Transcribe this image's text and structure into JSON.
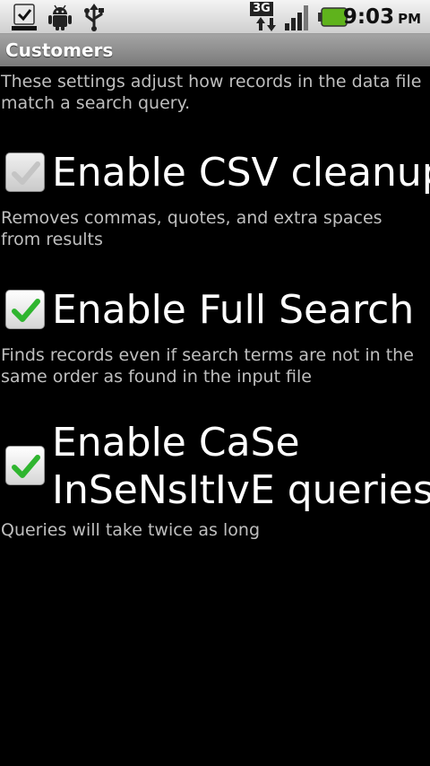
{
  "status_bar": {
    "time": "9:03",
    "ampm": "PM",
    "network_type": "3G",
    "icons": [
      "download-complete-icon",
      "android-debug-icon",
      "usb-icon",
      "3g-data-icon",
      "signal-strength-icon",
      "battery-icon"
    ],
    "battery_color": "#5fb31c"
  },
  "title_bar": {
    "title": "Customers"
  },
  "intro_text": "These settings adjust how records in the data file match a search query.",
  "preferences": [
    {
      "label": "Enable CSV cleanup",
      "summary": "Removes commas, quotes, and extra spaces from results",
      "checked": true,
      "enabled": false
    },
    {
      "label": "Enable Full Search",
      "summary": "Finds records even if search terms are not in the same order as found in the input file",
      "checked": true,
      "enabled": true
    },
    {
      "label_line1": "Enable CaSe",
      "label_line2": "InSeNsItIvE queries",
      "summary": "Queries will take twice as long",
      "checked": true,
      "enabled": true
    }
  ],
  "colors": {
    "background": "#000000",
    "summary_text": "#bfbfbf",
    "check_green": "#2fb52f",
    "check_disabled": "#c9c9c9"
  }
}
